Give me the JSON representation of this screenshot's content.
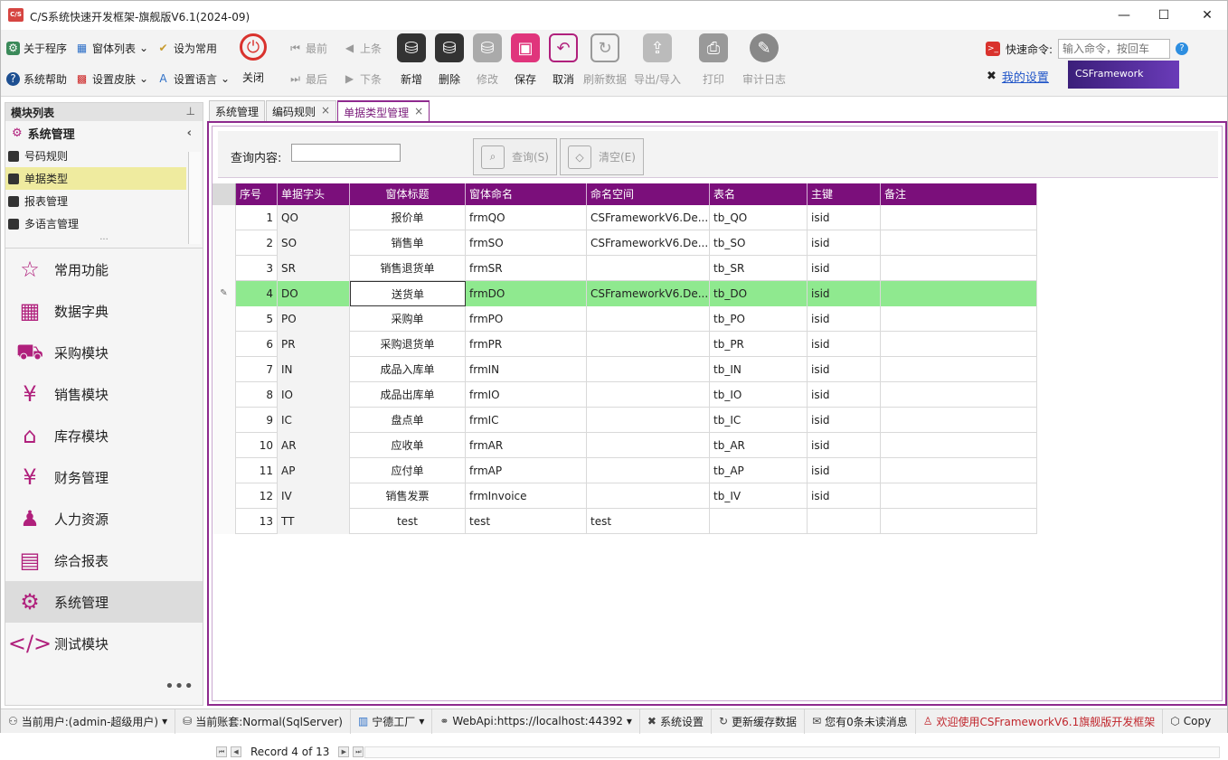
{
  "window": {
    "title": "C/S系统快速开发框架-旗舰版V6.1(2024-09)",
    "logo": "C/S",
    "minimize": "—",
    "maximize": "☐",
    "close": "✕"
  },
  "ribbon": {
    "about": "关于程序",
    "window_list": "窗体列表",
    "set_common": "设为常用",
    "help": "系统帮助",
    "skin": "设置皮肤",
    "language": "设置语言",
    "close": "关闭",
    "first": "最前",
    "prev": "上条",
    "last": "最后",
    "next": "下条",
    "add": "新增",
    "delete": "删除",
    "edit": "修改",
    "save": "保存",
    "cancel": "取消",
    "refresh": "刷新数据",
    "export": "导出/导入",
    "print": "打印",
    "audit": "审计日志",
    "quick_label": "快速命令:",
    "quick_placeholder": "输入命令，按回车",
    "my_settings": "我的设置",
    "brand": "CSFramework"
  },
  "sidebar": {
    "title": "模块列表",
    "pin": "⊥",
    "group": "系统管理",
    "items": [
      {
        "label": "号码规则",
        "selected": false
      },
      {
        "label": "单据类型",
        "selected": true
      },
      {
        "label": "报表管理",
        "selected": false
      },
      {
        "label": "多语言管理",
        "selected": false
      }
    ],
    "modules": [
      {
        "label": "常用功能",
        "icon": "☆"
      },
      {
        "label": "数据字典",
        "icon": "▦"
      },
      {
        "label": "采购模块",
        "icon": "⛟"
      },
      {
        "label": "销售模块",
        "icon": "¥"
      },
      {
        "label": "库存模块",
        "icon": "⌂"
      },
      {
        "label": "财务管理",
        "icon": "¥"
      },
      {
        "label": "人力资源",
        "icon": "♟"
      },
      {
        "label": "综合报表",
        "icon": "▤"
      },
      {
        "label": "系统管理",
        "icon": "⚙",
        "active": true
      },
      {
        "label": "测试模块",
        "icon": "</>"
      }
    ],
    "more": "•••"
  },
  "tabs": [
    {
      "label": "系统管理",
      "active": false,
      "close": false
    },
    {
      "label": "编码规则",
      "active": false,
      "close": true
    },
    {
      "label": "单据类型管理",
      "active": true,
      "close": true
    }
  ],
  "search": {
    "label": "查询内容:",
    "value": "",
    "query_button": "查询(S)",
    "clear_button": "清空(E)"
  },
  "grid": {
    "columns": [
      "序号",
      "单据字头",
      "窗体标题",
      "窗体命名",
      "命名空间",
      "表名",
      "主键",
      "备注"
    ],
    "rows": [
      [
        "1",
        "QO",
        "报价单",
        "frmQO",
        "CSFrameworkV6.De...",
        "tb_QO",
        "isid",
        ""
      ],
      [
        "2",
        "SO",
        "销售单",
        "frmSO",
        "CSFrameworkV6.De...",
        "tb_SO",
        "isid",
        ""
      ],
      [
        "3",
        "SR",
        "销售退货单",
        "frmSR",
        "",
        "tb_SR",
        "isid",
        ""
      ],
      [
        "4",
        "DO",
        "送货单",
        "frmDO",
        "CSFrameworkV6.De...",
        "tb_DO",
        "isid",
        ""
      ],
      [
        "5",
        "PO",
        "采购单",
        "frmPO",
        "",
        "tb_PO",
        "isid",
        ""
      ],
      [
        "6",
        "PR",
        "采购退货单",
        "frmPR",
        "",
        "tb_PR",
        "isid",
        ""
      ],
      [
        "7",
        "IN",
        "成品入库单",
        "frmIN",
        "",
        "tb_IN",
        "isid",
        ""
      ],
      [
        "8",
        "IO",
        "成品出库单",
        "frmIO",
        "",
        "tb_IO",
        "isid",
        ""
      ],
      [
        "9",
        "IC",
        "盘点单",
        "frmIC",
        "",
        "tb_IC",
        "isid",
        ""
      ],
      [
        "10",
        "AR",
        "应收单",
        "frmAR",
        "",
        "tb_AR",
        "isid",
        ""
      ],
      [
        "11",
        "AP",
        "应付单",
        "frmAP",
        "",
        "tb_AP",
        "isid",
        ""
      ],
      [
        "12",
        "IV",
        "销售发票",
        "frmInvoice",
        "",
        "tb_IV",
        "isid",
        ""
      ],
      [
        "13",
        "TT",
        "test",
        "test",
        "test",
        "",
        "",
        ""
      ]
    ],
    "selected_row": 4,
    "edit_indicator": "✎",
    "record_text": "Record 4 of 13"
  },
  "status": {
    "user": "当前用户:(admin-超级用户)",
    "account": "当前账套:Normal(SqlServer)",
    "factory": "宁德工厂",
    "webapi": "WebApi:https://localhost:44392",
    "settings": "系统设置",
    "refresh_cache": "更新缓存数据",
    "messages": "您有0条未读消息",
    "welcome": "欢迎使用CSFrameworkV6.1旗舰版开发框架",
    "copy": "Copy"
  },
  "colors": {
    "accent": "#7b0f7b",
    "selected_row": "#8fe98f",
    "sidebar_selected": "#efeb9f",
    "red": "#c0262c"
  }
}
